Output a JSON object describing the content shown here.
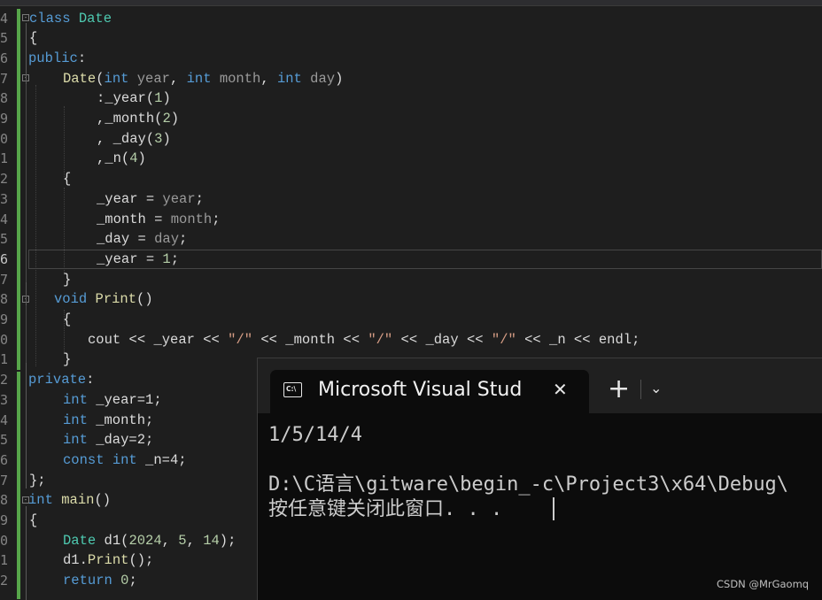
{
  "editor": {
    "line_numbers": [
      "4",
      "5",
      "6",
      "7",
      "8",
      "9",
      "0",
      "1",
      "2",
      "3",
      "4",
      "5",
      "6",
      "7",
      "8",
      "9",
      "0",
      "1",
      "2",
      "3",
      "4",
      "5",
      "6",
      "7",
      "8",
      "9",
      "0",
      "1",
      "2"
    ],
    "current_line_index": 12,
    "code": {
      "l4": {
        "kw": "class",
        "name": "Date"
      },
      "l5": {
        "brace": "{"
      },
      "l6": {
        "kw": "public",
        "colon": ":"
      },
      "l7": {
        "fn": "Date",
        "open": "(",
        "t1": "int",
        "p1": "year",
        "c1": ",",
        "t2": "int",
        "p2": "month",
        "c2": ",",
        "t3": "int",
        "p3": "day",
        "close": ")"
      },
      "l8": {
        "pre": ":",
        "m": "_year",
        "open": "(",
        "num": "1",
        "close": ")"
      },
      "l9": {
        "pre": ",",
        "m": "_month",
        "open": "(",
        "num": "2",
        "close": ")"
      },
      "l10": {
        "pre": ", ",
        "m": "_day",
        "open": "(",
        "num": "3",
        "close": ")"
      },
      "l11": {
        "pre": ",",
        "m": "_n",
        "open": "(",
        "num": "4",
        "close": ")"
      },
      "l12": {
        "brace": "{"
      },
      "l13": {
        "m": "_year",
        "op": " = ",
        "v": "year",
        "semi": ";"
      },
      "l14": {
        "m": "_month",
        "op": " = ",
        "v": "month",
        "semi": ";"
      },
      "l15": {
        "m": "_day",
        "op": " = ",
        "v": "day",
        "semi": ";"
      },
      "l16": {
        "m": "_year",
        "op": " = ",
        "num": "1",
        "semi": ";"
      },
      "l17": {
        "brace": "}"
      },
      "l18": {
        "kw": "void",
        "fn": "Print",
        "parens": "()"
      },
      "l19": {
        "brace": "{"
      },
      "l20": {
        "cout": "cout",
        "op1": " << ",
        "m1": "_year",
        "op2": " << ",
        "s1": "\"/\"",
        "op3": " << ",
        "m2": "_month",
        "op4": " << ",
        "s2": "\"/\"",
        "op5": " << ",
        "m3": "_day",
        "op6": " << ",
        "s3": "\"/\"",
        "op7": " << ",
        "m4": "_n",
        "op8": " << ",
        "endl": "endl",
        "semi": ";"
      },
      "l21": {
        "brace": "}"
      },
      "l22": {
        "kw": "private",
        "colon": ":"
      },
      "l23": {
        "kw": "int",
        "rest": " _year=1;"
      },
      "l24": {
        "kw": "int",
        "rest": " _month;"
      },
      "l25": {
        "kw": "int",
        "rest": " _day=2;"
      },
      "l26": {
        "kw1": "const",
        "kw2": "int",
        "rest": " _n=4;"
      },
      "l27": {
        "text": "};"
      },
      "l28": {
        "kw": "int",
        "fn": "main",
        "parens": "()"
      },
      "l29": {
        "brace": "{"
      },
      "l30": {
        "type": "Date",
        "rest": " d1(",
        "n1": "2024",
        "c1": ", ",
        "n2": "5",
        "c2": ", ",
        "n3": "14",
        "end": ");"
      },
      "l31": {
        "obj": "d1",
        "dot": ".",
        "fn": "Print",
        "end": "();"
      },
      "l32": {
        "kw": "return",
        "sp": " ",
        "num": "0",
        "semi": ";"
      }
    }
  },
  "terminal": {
    "tab_icon_text": "C:\\",
    "tab_title": "Microsoft Visual Stud",
    "close_glyph": "✕",
    "new_tab_glyph": "+",
    "dropdown_glyph": "⌄",
    "output_line_1": "1/5/14/4",
    "output_line_2": "D:\\C语言\\gitware\\begin_-c\\Project3\\x64\\Debug\\",
    "output_line_3": "按任意键关闭此窗口. . ."
  },
  "watermark": "CSDN @MrGaomq",
  "colors": {
    "editor_bg": "#1e1e1e",
    "keyword": "#569cd6",
    "type": "#4ec9b0",
    "function": "#dcdcaa",
    "string": "#d69d85",
    "number": "#b5cea8",
    "terminal_bg": "#0c0c0c",
    "change_bar": "#57a64a"
  }
}
